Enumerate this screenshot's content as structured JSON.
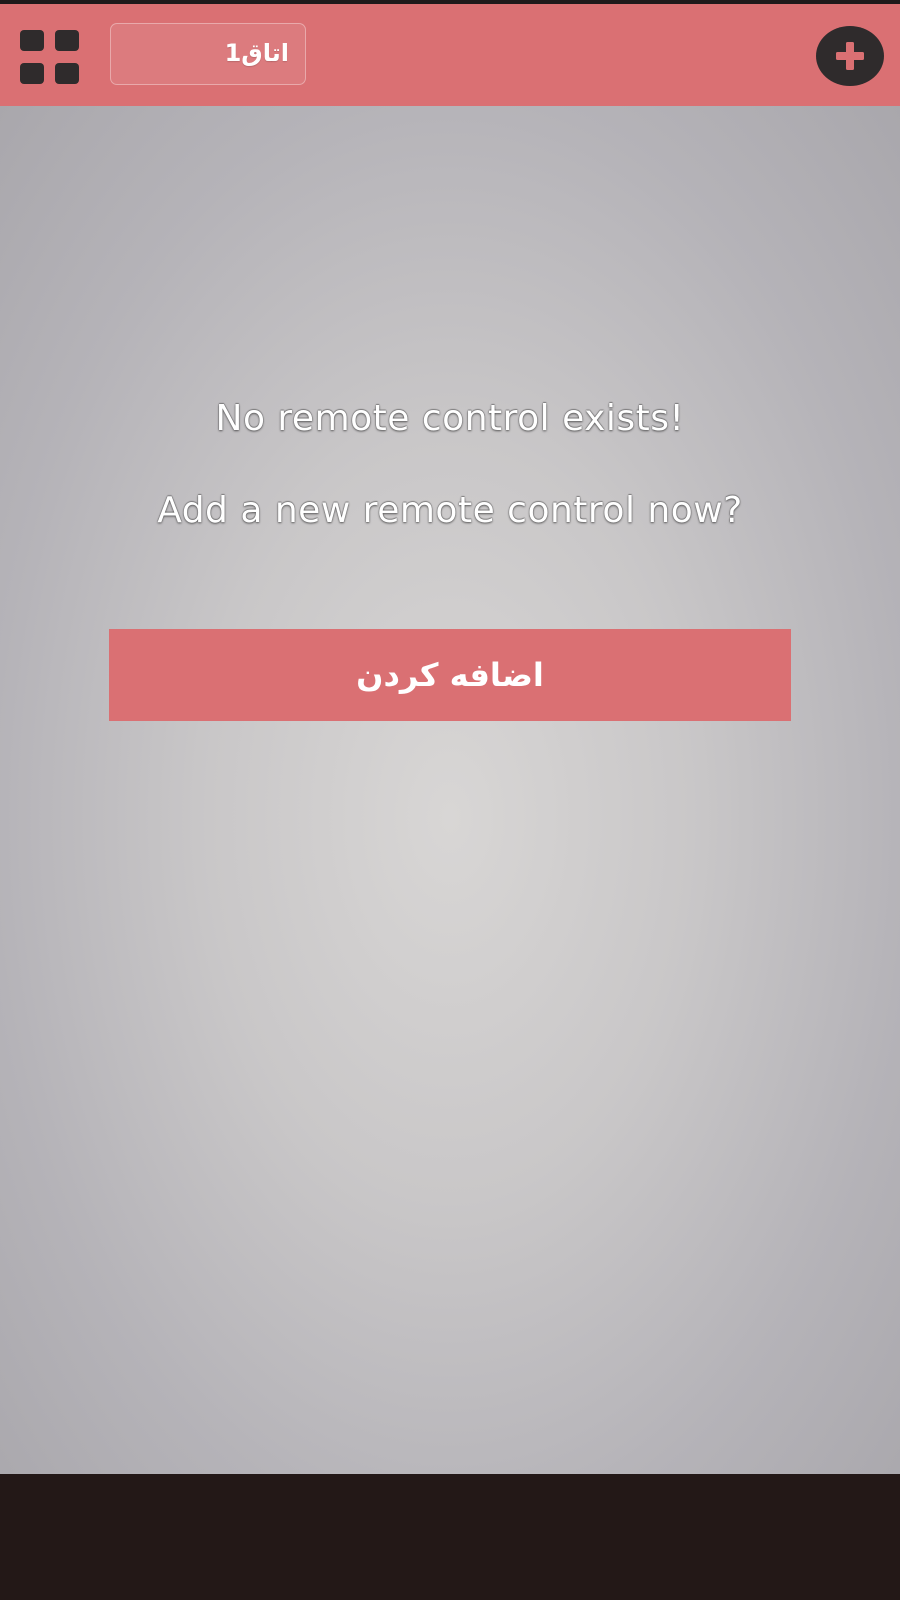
{
  "header": {
    "menu_icon": "grid-icon",
    "room_name": "اتاق1",
    "add_icon": "plus-circle-icon"
  },
  "main": {
    "message_line1": "No remote control exists!",
    "message_line2": "Add a new remote control now?",
    "add_button_label": "اضافه کردن"
  },
  "colors": {
    "accent": "#da7073",
    "icon_dark": "#2f2b2c",
    "background_center": "#d8d6d5",
    "background_edge": "#a9a7ac",
    "bottom_bar": "#231817"
  }
}
